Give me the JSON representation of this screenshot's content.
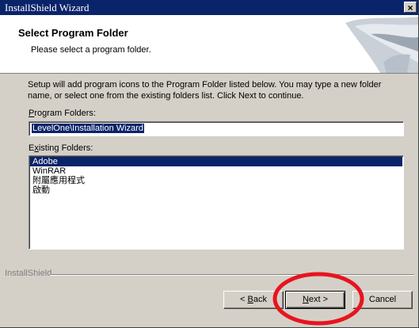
{
  "window": {
    "title": "InstallShield Wizard",
    "close_glyph": "×"
  },
  "header": {
    "heading": "Select Program Folder",
    "subheading": "Please select a program folder."
  },
  "intro_text": "Setup will add program icons to the Program Folder listed below.  You may type a new folder name, or select one from the existing folders list.  Click Next to continue.",
  "program_folders": {
    "label_accel": "P",
    "label_rest": "rogram Folders:",
    "value": "LevelOne\\Installation Wizard"
  },
  "existing_folders": {
    "label_pre": "E",
    "label_accel": "x",
    "label_rest": "isting Folders:",
    "items": [
      "Adobe",
      "WinRAR",
      "附屬應用程式",
      "啟動"
    ],
    "selected_index": 0
  },
  "footer": {
    "brand": "InstallShield"
  },
  "buttons": {
    "back_pre": "< ",
    "back_accel": "B",
    "back_rest": "ack",
    "next_accel": "N",
    "next_rest": "ext >",
    "cancel": "Cancel"
  },
  "colors": {
    "title_bar": "#0a246a",
    "face": "#d4d0c8",
    "selection": "#0a246a",
    "annotation_circle": "#e8141e"
  }
}
